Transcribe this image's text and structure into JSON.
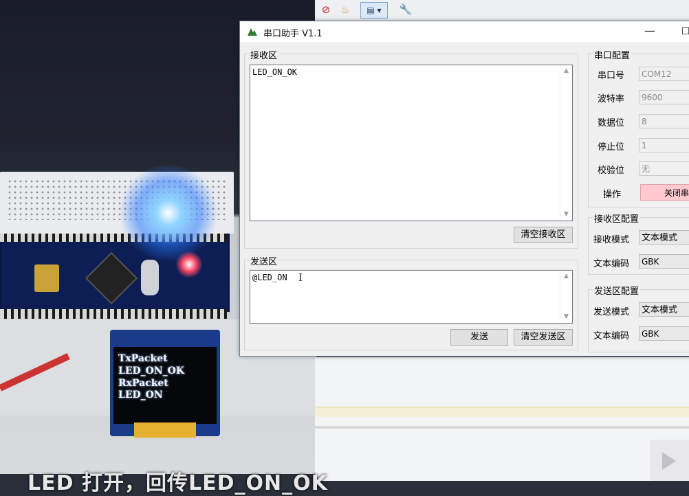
{
  "window": {
    "title": "串口助手 V1.1"
  },
  "receive": {
    "group_label": "接收区",
    "text": "LED_ON_OK",
    "clear_button": "清空接收区"
  },
  "send": {
    "group_label": "发送区",
    "text": "@LED_ON",
    "send_button": "发送",
    "clear_button": "清空发送区"
  },
  "serial_config": {
    "group_label": "串口配置",
    "port": {
      "label": "串口号",
      "value": "COM12"
    },
    "baud": {
      "label": "波特率",
      "value": "9600"
    },
    "databits": {
      "label": "数据位",
      "value": "8"
    },
    "stopbits": {
      "label": "停止位",
      "value": "1"
    },
    "parity": {
      "label": "校验位",
      "value": "无"
    },
    "operation": {
      "label": "操作",
      "button": "关闭串"
    }
  },
  "receive_config": {
    "group_label": "接收区配置",
    "mode": {
      "label": "接收模式",
      "value": "文本模式"
    },
    "encoding": {
      "label": "文本编码",
      "value": "GBK"
    }
  },
  "send_config": {
    "group_label": "发送区配置",
    "mode": {
      "label": "发送模式",
      "value": "文本模式"
    },
    "encoding": {
      "label": "文本编码",
      "value": "GBK"
    }
  },
  "oled": {
    "lines": [
      "TxPacket",
      "LED_ON_OK",
      "RxPacket",
      "LED_ON"
    ]
  },
  "subtitle": "LED 打开，回传LED_ON_OK",
  "colors": {
    "op_button": "#ffc9cf",
    "led_blue": "#8fd4ff",
    "led_red": "#ff4a6a"
  }
}
